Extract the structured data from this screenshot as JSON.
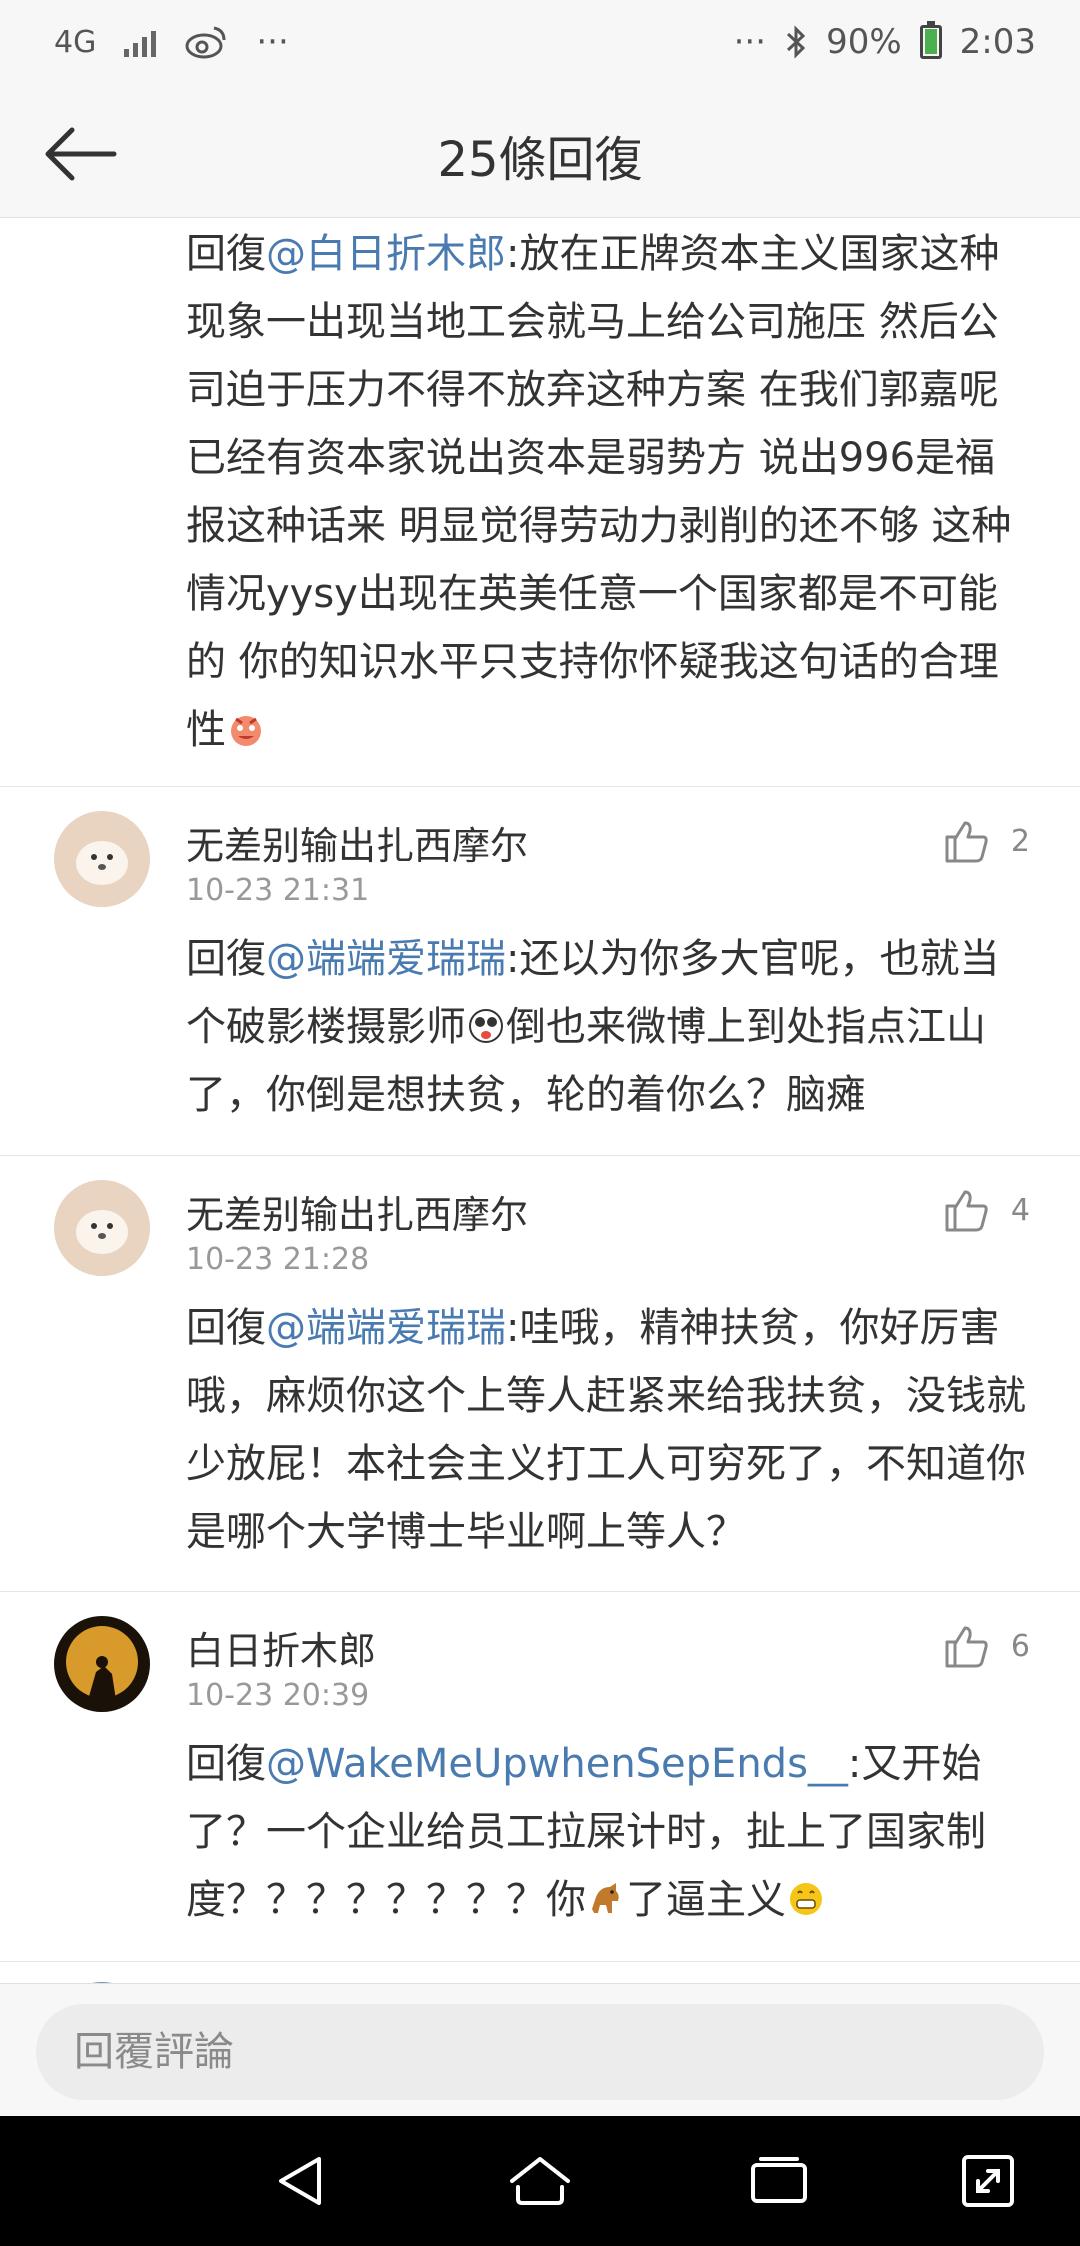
{
  "status_bar": {
    "network": "4G",
    "ellipsis_left": "···",
    "ellipsis_right": "···",
    "battery": "90%",
    "time": "2:03",
    "battery_level": 0.9
  },
  "header": {
    "title": "25條回復"
  },
  "comments": [
    {
      "reply_prefix": "回復",
      "mention": "@白日折木郎",
      "body": ":放在正牌资本主义国家这种现象一出现当地工会就马上给公司施压 然后公司迫于压力不得不放弃这种方案 在我们郭嘉呢 已经有资本家说出资本是弱势方 说出996是福报这种话来 明显觉得劳动力剥削的还不够 这种情况yysy出现在英美任意一个国家都是不可能的 你的知识水平只支持你怀疑我这句话的合理性"
    },
    {
      "username": "无差别输出扎西摩尔",
      "time": "10-23 21:31",
      "likes": "2",
      "reply_prefix": "回復",
      "mention": "@端端爱瑞瑞",
      "body_a": ":还以为你多大官呢，也就当个破影楼摄影师",
      "body_b": "倒也来微博上到处指点江山了，你倒是想扶贫，轮的着你么？脑瘫"
    },
    {
      "username": "无差别输出扎西摩尔",
      "time": "10-23 21:28",
      "likes": "4",
      "reply_prefix": "回復",
      "mention": "@端端爱瑞瑞",
      "body": ":哇哦，精神扶贫，你好厉害哦，麻烦你这个上等人赶紧来给我扶贫，没钱就少放屁！本社会主义打工人可穷死了，不知道你是哪个大学博士毕业啊上等人？"
    },
    {
      "username": "白日折木郎",
      "time": "10-23 20:39",
      "likes": "6",
      "reply_prefix": "回復",
      "mention": "@WakeMeUpwhenSepEnds__",
      "body_a": ":又开始了？一个企业给员工拉屎计时，扯上了国家制度？？？？？？？？你",
      "body_b": "了逼主义"
    }
  ],
  "reply_bar": {
    "placeholder": "回覆評論"
  },
  "colors": {
    "mention": "#4a7bb0",
    "muted": "#999999",
    "background": "#ffffff",
    "bar": "#f7f7f7"
  }
}
